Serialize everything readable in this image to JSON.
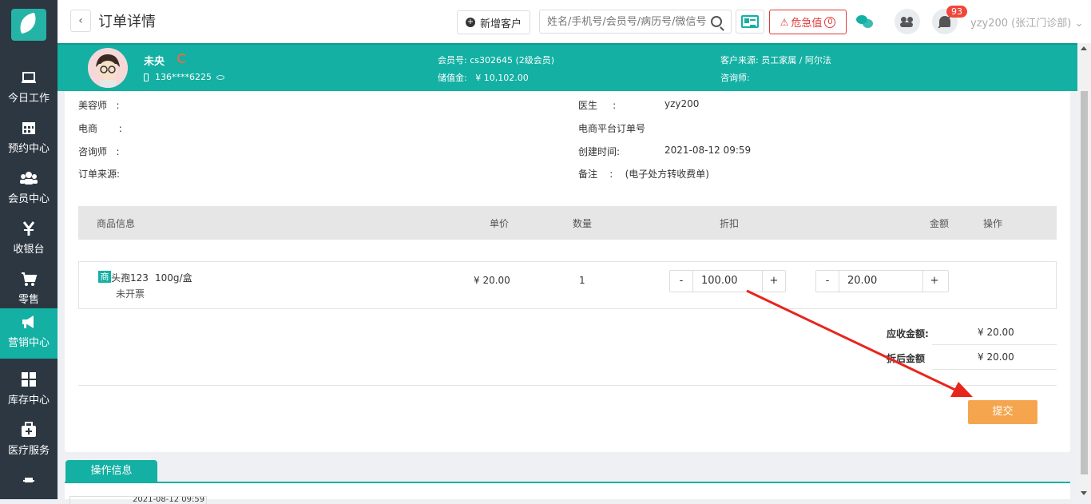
{
  "sidebar": {
    "items": [
      {
        "label": "今日工作",
        "icon": "laptop-icon"
      },
      {
        "label": "预约中心",
        "icon": "calendar-icon"
      },
      {
        "label": "会员中心",
        "icon": "users-icon"
      },
      {
        "label": "收银台",
        "icon": "yen-icon"
      },
      {
        "label": "零售",
        "icon": "cart-icon"
      },
      {
        "label": "营销中心",
        "icon": "megaphone-icon"
      },
      {
        "label": "库存中心",
        "icon": "grid-icon"
      },
      {
        "label": "医疗服务",
        "icon": "medkit-icon"
      }
    ],
    "active_index": 5,
    "active_color": "#13b0a3"
  },
  "header": {
    "back_symbol": "‹",
    "title": "订单详情",
    "new_customer_label": "新增客户",
    "search_placeholder": "姓名/手机号/会员号/病历号/微信号",
    "danger_label": "危急值",
    "danger_count": "0",
    "notification_badge": "93",
    "user": "yzy200 (张江门诊部)"
  },
  "customer": {
    "name": "未央",
    "phone": "136****6225",
    "member_no_label": "会员号:",
    "member_no": "cs302645 (2级会员)",
    "stored_value_label": "储值金:",
    "stored_value": "¥ 10,102.00",
    "source_label": "客户来源:",
    "source": "员工家属 / 阿尔法",
    "consultant_label": "咨询师:",
    "consultant": ""
  },
  "order_info": {
    "beautician_label": "美容师",
    "ecommerce_label": "电商",
    "consultant_label": "咨询师",
    "source_label": "订单来源:",
    "doctor_label": "医生",
    "doctor": "yzy200",
    "platform_order_label": "电商平台订单号",
    "created_label": "创建时间:",
    "created": "2021-08-12 09:59",
    "remark_label": "备注",
    "remark": "(电子处方转收费单)"
  },
  "table": {
    "headers": [
      "商品信息",
      "单价",
      "数量",
      "折扣",
      "金额",
      "操作"
    ],
    "rows": [
      {
        "tag": "商",
        "name": "头孢123",
        "spec": "100g/盒",
        "invoice": "未开票",
        "price": "¥ 20.00",
        "qty": "1",
        "discount": "100.00",
        "amount": "20.00"
      }
    ]
  },
  "summary": {
    "receivable_label": "应收金额:",
    "receivable": "¥ 20.00",
    "after_discount_label": "折后金额",
    "after_discount": "¥ 20.00"
  },
  "submit_label": "提交",
  "operation": {
    "tab_label": "操作信息",
    "row_text": "2021-08-12 09:59"
  },
  "colors": {
    "brand": "#13b0a3",
    "submit": "#f6a54f",
    "danger": "#e03a3a",
    "annotation_arrow": "#e8251c"
  }
}
